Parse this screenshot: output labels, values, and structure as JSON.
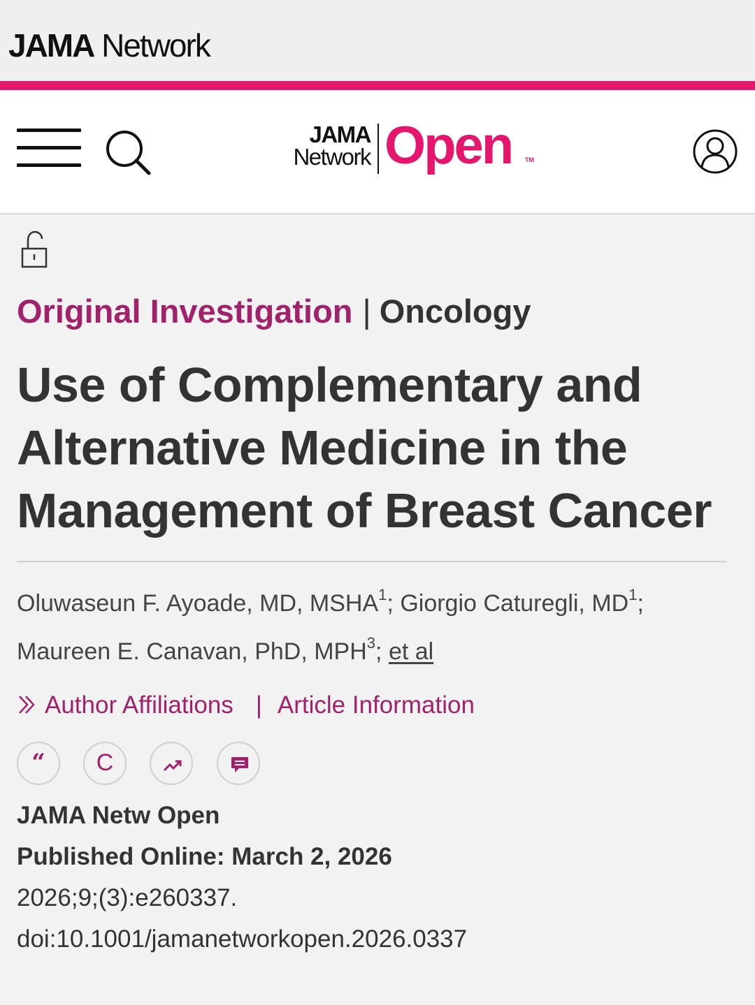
{
  "network_brand": {
    "bold": "JAMA",
    "rest": " Network"
  },
  "journal_logo": {
    "line1": "JAMA",
    "line2": "Network",
    "open": "Open",
    "tm": "TM"
  },
  "colors": {
    "accent": "#e5166e",
    "category": "#a0226a",
    "text": "#333333"
  },
  "icons": [
    "menu-icon",
    "search-icon",
    "user-icon",
    "unlock-icon",
    "quote-icon",
    "copyright-icon",
    "trending-icon",
    "comment-icon",
    "chevron-right-icon"
  ],
  "article": {
    "category_type": "Original Investigation",
    "category_sep": "|",
    "category_topic": "Oncology",
    "title": "Use of Complementary and Alternative Medicine in the Management of Breast Cancer",
    "authors": [
      {
        "name": "Oluwaseun F. Ayoade, MD, MSHA",
        "aff": "1"
      },
      {
        "name": "Giorgio Caturegli, MD",
        "aff": "1"
      },
      {
        "name": "Maureen E. Canavan, PhD, MPH",
        "aff": "3"
      }
    ],
    "author_sep": ";",
    "et_al": "et al",
    "links": {
      "affiliations": "Author Affiliations",
      "sep": "|",
      "information": "Article Information"
    },
    "tools": {
      "quote_glyph": "“",
      "copyright_glyph": "C"
    },
    "journal": "JAMA Netw Open",
    "published": "Published Online: March 2, 2026",
    "citation": "2026;9;(3):e260337.",
    "doi": "doi:10.1001/jamanetworkopen.2026.0337"
  }
}
